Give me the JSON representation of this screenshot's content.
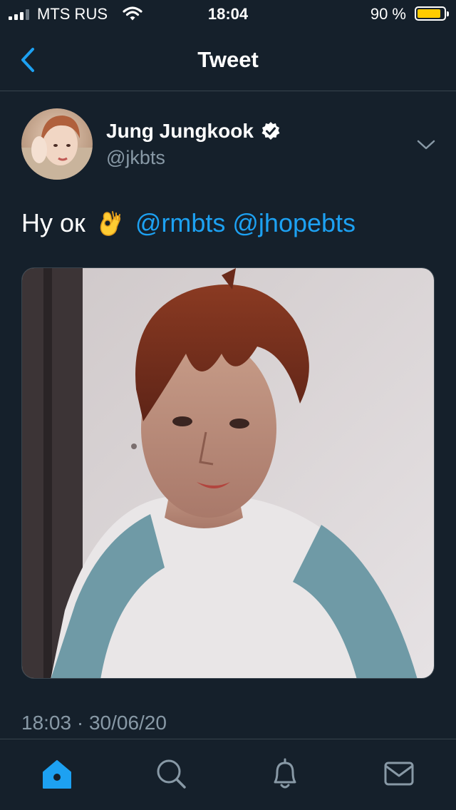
{
  "status_bar": {
    "carrier": "MTS RUS",
    "time": "18:04",
    "battery_percent_text": "90 %",
    "battery_level": 0.9,
    "signal_bars": 3,
    "battery_color": "#ffcc00"
  },
  "header": {
    "title": "Tweet",
    "back_icon": "chevron-left-icon"
  },
  "tweet": {
    "author_name": "Jung Jungkook",
    "verified": true,
    "handle": "@jkbts",
    "text_prefix": "Ну ок",
    "emoji": "👌",
    "mentions": [
      "@rmbts",
      "@jhopebts"
    ],
    "timestamp": "18:03 · 30/06/20"
  },
  "tab_bar": {
    "tabs": [
      "home",
      "search",
      "notifications",
      "messages"
    ],
    "active": "home"
  },
  "colors": {
    "background": "#15202b",
    "accent": "#1da1f2",
    "secondary_text": "#8899a6",
    "divider": "#38444d"
  }
}
